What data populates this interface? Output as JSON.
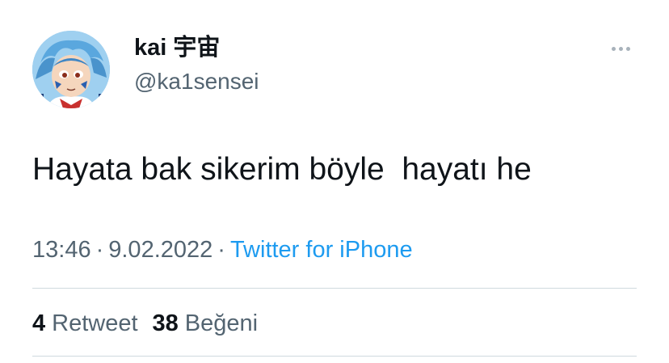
{
  "author": {
    "display_name": "kai 宇宙",
    "handle": "@ka1sensei"
  },
  "tweet": {
    "text": "Hayata bak sikerim böyle  hayatı he",
    "time": "13:46",
    "separator": "·",
    "date": "9.02.2022",
    "source": "Twitter for iPhone"
  },
  "stats": {
    "retweets_count": "4",
    "retweets_label": "Retweet",
    "likes_count": "38",
    "likes_label": "Beğeni"
  },
  "icons": {
    "more": "more-horizontal-icon",
    "avatar": "avatar-image"
  },
  "colors": {
    "text_primary": "#0f1419",
    "text_secondary": "#536471",
    "link": "#1d9bf0",
    "divider": "#cfd9de"
  }
}
